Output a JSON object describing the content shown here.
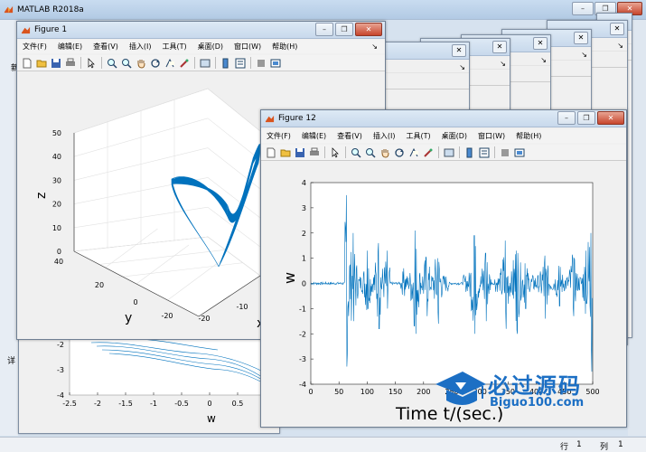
{
  "main_window": {
    "title": "MATLAB R2018a",
    "left_hint_char": "新",
    "left_label": "详",
    "status": {
      "row_label": "行",
      "row_value": "1",
      "col_label": "列",
      "col_value": "1"
    }
  },
  "menus": [
    "文件(F)",
    "编辑(E)",
    "查看(V)",
    "插入(I)",
    "工具(T)",
    "桌面(D)",
    "窗口(W)",
    "帮助(H)"
  ],
  "menu_arrow": "↘",
  "window_buttons": {
    "minimize": "–",
    "restore": "❐",
    "close": "✕"
  },
  "figure1": {
    "title": "Figure 1",
    "plot": {
      "zlabel": "z",
      "ylabel": "y",
      "xlabel": "x",
      "z_ticks": [
        "0",
        "10",
        "20",
        "30",
        "40",
        "50"
      ],
      "y_ticks": [
        "40",
        "20",
        "0",
        "-20"
      ],
      "x_ticks": [
        "-20",
        "-10"
      ]
    }
  },
  "figure12": {
    "title": "Figure 12",
    "chart_data": {
      "type": "line",
      "title": "",
      "xlabel": "Time t/(sec.)",
      "ylabel": "w",
      "xlim": [
        0,
        500
      ],
      "ylim": [
        -4,
        4
      ],
      "x_ticks": [
        "0",
        "50",
        "100",
        "150",
        "200",
        "250",
        "300",
        "350",
        "400",
        "450",
        "500"
      ],
      "y_ticks": [
        "4",
        "3",
        "2",
        "1",
        "0",
        "-1",
        "-2",
        "-3",
        "-4"
      ],
      "color": "#0072BD",
      "quiet_intervals": [
        [
          0,
          60
        ],
        [
          140,
          160
        ],
        [
          245,
          270
        ],
        [
          320,
          325
        ]
      ],
      "burst_peaks": [
        [
          63,
          3.5,
          -3.3
        ],
        [
          75,
          2.0,
          -1.5
        ],
        [
          100,
          1.3,
          -1.0
        ],
        [
          120,
          1.6,
          -1.8
        ],
        [
          135,
          1.3,
          -1.0
        ],
        [
          165,
          0.6,
          -0.5
        ],
        [
          185,
          2.1,
          -2.0
        ],
        [
          205,
          1.0,
          -1.3
        ],
        [
          225,
          1.0,
          -1.6
        ],
        [
          290,
          1.9,
          -2.0
        ],
        [
          310,
          1.2,
          -1.5
        ],
        [
          345,
          1.7,
          -1.8
        ],
        [
          365,
          1.3,
          -2.0
        ],
        [
          380,
          0.8,
          -1.0
        ],
        [
          415,
          1.1,
          -1.4
        ],
        [
          440,
          0.7,
          -0.9
        ],
        [
          465,
          1.0,
          -1.3
        ],
        [
          488,
          1.3,
          -0.8
        ],
        [
          497,
          2.0,
          -3.5
        ]
      ]
    }
  },
  "bg_plot": {
    "xlabel": "w",
    "x_ticks": [
      "-2.5",
      "-2",
      "-1.5",
      "-1",
      "-0.5",
      "0",
      "0.5"
    ],
    "y_ticks": [
      "-2",
      "-3",
      "-4"
    ]
  },
  "watermark": {
    "cn": "必过源码",
    "en": "Biguo100.com"
  }
}
